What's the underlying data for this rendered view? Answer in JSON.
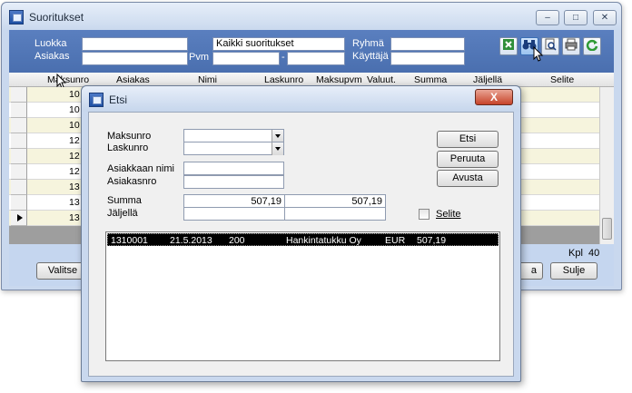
{
  "main_window": {
    "title": "Suoritukset",
    "caption_min": "–",
    "caption_max": "□",
    "caption_close": "✕"
  },
  "filters": {
    "luokka_label": "Luokka",
    "asiakas_label": "Asiakas",
    "pvm_label": "Pvm",
    "pvm_separator": "-",
    "description_value": "Kaikki suoritukset",
    "ryhma_label": "Ryhmä",
    "kayttaja_label": "Käyttäjä"
  },
  "toolbar_icons": [
    "excel-icon",
    "binoculars-icon",
    "print-preview-icon",
    "printer-icon",
    "refresh-icon"
  ],
  "grid": {
    "columns": [
      "Maksunro",
      "Asiakas",
      "Nimi",
      "Laskunro",
      "Maksupvm",
      "Valuut.",
      "Summa",
      "Jäljellä",
      "Selite"
    ],
    "visible_row_prefixes": [
      "10",
      "10",
      "10",
      "12",
      "12",
      "12",
      "13",
      "13",
      "13"
    ],
    "current_row_index": 8
  },
  "status": {
    "kpl_label": "Kpl",
    "kpl_value": "40"
  },
  "buttons": {
    "valitse": "Valitse",
    "partial_right": "a",
    "sulje": "Sulje"
  },
  "dialog": {
    "title": "Etsi",
    "close_glyph": "X",
    "maksunro_label": "Maksunro",
    "laskunro_label": "Laskunro",
    "asiakkaan_nimi_label": "Asiakkaan nimi",
    "asiakasnro_label": "Asiakasnro",
    "summa_label": "Summa",
    "jaljella_label": "Jäljellä",
    "summa_from": "507,19",
    "summa_to": "507,19",
    "selite_label": "Selite",
    "etsi_button": "Etsi",
    "peruuta_button": "Peruuta",
    "avusta_button": "Avusta",
    "result_row": {
      "maksunro": "1310001",
      "pvm": "21.5.2013",
      "asiakas": "200",
      "nimi": "Hankintatukku Oy",
      "valuutta": "EUR",
      "summa": "507,19"
    }
  }
}
